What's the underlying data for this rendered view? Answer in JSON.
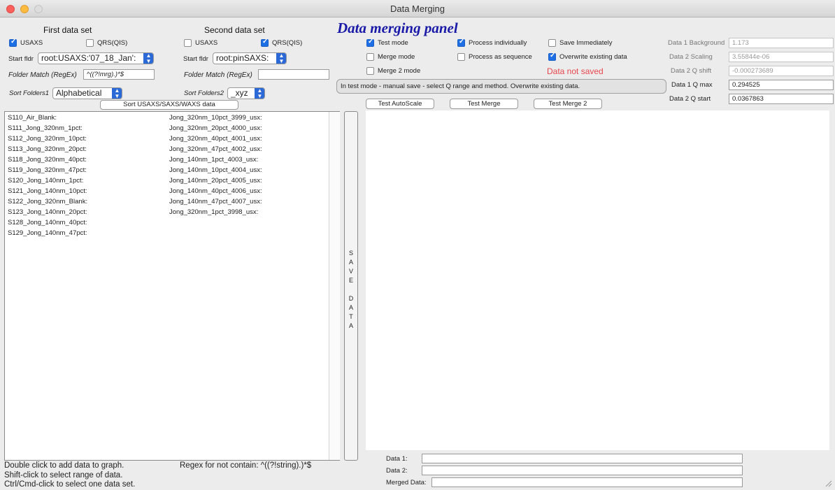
{
  "window": {
    "title": "Data Merging"
  },
  "panel_title": "Data merging  panel",
  "first": {
    "heading": "First data set",
    "usaxs": {
      "label": "USAXS",
      "checked": true
    },
    "qrs": {
      "label": "QRS(QIS)",
      "checked": false
    },
    "start_fldr_label": "Start fldr",
    "start_fldr_value": "root:USAXS:'07_18_Jan':",
    "folder_match_label": "Folder Match (RegEx)",
    "folder_match_value": "^((?!mrg).)*$",
    "sort_label": "Sort Folders1",
    "sort_value": "Alphabetical",
    "sort_button": "Sort USAXS/SAXS/WAXS data"
  },
  "second": {
    "heading": "Second data set",
    "usaxs": {
      "label": "USAXS",
      "checked": false
    },
    "qrs": {
      "label": "QRS(QIS)",
      "checked": true
    },
    "start_fldr_label": "Start fldr",
    "start_fldr_value": "root:pinSAXS:",
    "folder_match_label": "Folder Match (RegEx)",
    "folder_match_value": "",
    "sort_label": "Sort Folders2",
    "sort_value": "_xyz"
  },
  "options": {
    "test_mode": {
      "label": "Test mode",
      "checked": true
    },
    "merge_mode": {
      "label": "Merge mode",
      "checked": false
    },
    "merge2_mode": {
      "label": "Merge 2 mode",
      "checked": false
    },
    "process_individually": {
      "label": "Process individually",
      "checked": true
    },
    "process_sequence": {
      "label": "Process as sequence",
      "checked": false
    },
    "save_immediately": {
      "label": "Save Immediately",
      "checked": false
    },
    "overwrite": {
      "label": "Overwrite existing data",
      "checked": true
    }
  },
  "not_saved": "Data not saved",
  "status_message": "In test mode - manual save - select Q range and method. Overwrite existing data.",
  "buttons": {
    "test_autoscale": "Test AutoScale",
    "test_merge": "Test Merge",
    "test_merge2": "Test Merge 2"
  },
  "params": {
    "bg": {
      "label": "Data 1 Background",
      "value": "1.173"
    },
    "scaling": {
      "label": "Data 2 Scaling",
      "value": "3.55844e-06"
    },
    "qshift": {
      "label": "Data 2 Q shift",
      "value": "-0.000273689"
    },
    "qmax": {
      "label": "Data 1 Q max",
      "value": "0.294525"
    },
    "qstart": {
      "label": "Data 2 Q start",
      "value": "0.0367863"
    }
  },
  "list1": [
    "S110_Air_Blank:",
    "S111_Jong_320nm_1pct:",
    "S112_Jong_320nm_10pct:",
    "S113_Jong_320nm_20pct:",
    "S118_Jong_320nm_40pct:",
    "S119_Jong_320nm_47pct:",
    "S120_Jong_140nm_1pct:",
    "S121_Jong_140nm_10pct:",
    "S122_Jong_320nm_Blank:",
    "S123_Jong_140nm_20pct:",
    "S128_Jong_140nm_40pct:",
    "S129_Jong_140nm_47pct:"
  ],
  "list2": [
    "Jong_320nm_10pct_3999_usx:",
    "Jong_320nm_20pct_4000_usx:",
    "Jong_320nm_40pct_4001_usx:",
    "Jong_320nm_47pct_4002_usx:",
    "Jong_140nm_1pct_4003_usx:",
    "Jong_140nm_10pct_4004_usx:",
    "Jong_140nm_20pct_4005_usx:",
    "Jong_140nm_40pct_4006_usx:",
    "Jong_140nm_47pct_4007_usx:",
    "Jong_320nm_1pct_3998_usx:"
  ],
  "save_data": "SAVE DATA",
  "help": {
    "line1": "Double click to add data to graph.",
    "line2": "Shift-click to select range of data.",
    "line3": "Ctrl/Cmd-click to select one data set.",
    "regex_hint": "Regex for not contain: ^((?!string).)*$"
  },
  "bottom": {
    "data1_label": "Data 1:",
    "data2_label": "Data 2:",
    "merged_label": "Merged Data:",
    "data1_value": "",
    "data2_value": "",
    "merged_value": ""
  }
}
